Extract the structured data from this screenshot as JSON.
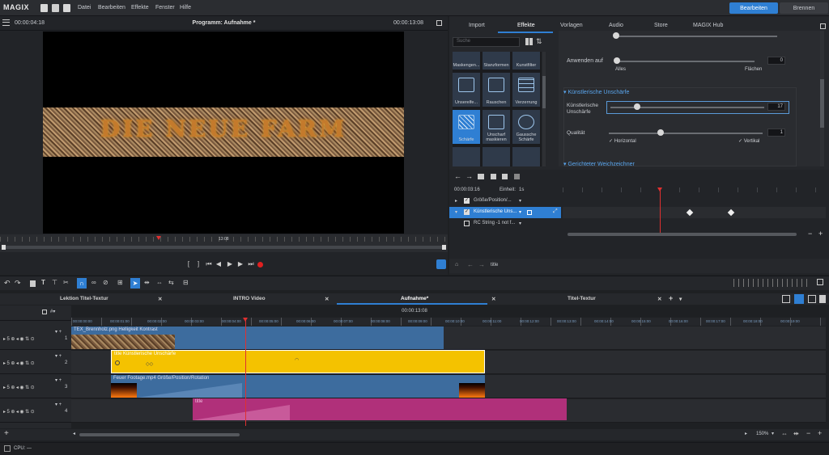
{
  "app": {
    "logo": "MAGIX",
    "menus": [
      "Datei",
      "Bearbeiten",
      "Effekte",
      "Fenster",
      "Hilfe"
    ],
    "mode_buttons": [
      "Bearbeiten",
      "Brennen"
    ]
  },
  "program": {
    "timecode_left": "00:00:04:18",
    "title": "Programm: Aufnahme *",
    "timecode_right": "00:00:13:08",
    "ruler_time": "13:08",
    "title_text": "DIE NEUE FARM"
  },
  "media_tabs": [
    "Import",
    "Effekte",
    "Vorlagen",
    "Audio",
    "Store",
    "MAGIX Hub"
  ],
  "search": {
    "placeholder": "Suche"
  },
  "effects": [
    {
      "label": "Maskengen..."
    },
    {
      "label": "Stanzformen"
    },
    {
      "label": "Kunstfilter"
    },
    {
      "label": "Unserelfe..."
    },
    {
      "label": "Rauschen"
    },
    {
      "label": "Verzerrung"
    },
    {
      "label": "Schärfe"
    },
    {
      "label": "Unscharf maskieren"
    },
    {
      "label": "Gaussche Schärfe"
    }
  ],
  "props": {
    "anwenden_label": "Anwenden auf",
    "anwenden_value": "0",
    "alles": "Alles",
    "flaechen": "Flächen",
    "section1": "Künstlerische Unschärfe",
    "ku_label": "Künstlerische Unschärfe",
    "ku_value": "17",
    "qual_label": "Qualität",
    "qual_value": "1",
    "horizontal": "Horizontal",
    "vertikal": "Vertikal",
    "section2": "Gerichteter Weichzeichner"
  },
  "keyframes": {
    "time": "00:00:03:16",
    "unit_label": "Einheit:",
    "unit": "1s",
    "rows": [
      "Größe/Position/...",
      "Künstlerische Uns...",
      "RC String -1 not f..."
    ],
    "footer": "title"
  },
  "arrangement_tabs": [
    "Lektion Titel-Textur",
    "INTRO Video",
    "Aufnahme*",
    "Titel-Textur"
  ],
  "timeline": {
    "timecode": "00:00:13:08",
    "ruler": [
      "00:00:00:00",
      "00:00:01:00",
      "00:00:02:00",
      "00:00:03:00",
      "00:00:04:00",
      "00:00:05:00",
      "00:00:06:00",
      "00:00:07:00",
      "00:00:08:00",
      "00:00:09:00",
      "00:00:10:00",
      "00:00:11:00",
      "00:00:12:00",
      "00:00:13:00",
      "00:00:14:00",
      "00:00:15:00",
      "00:00:16:00",
      "00:00:17:00",
      "00:00:18:00",
      "00:00:19:00"
    ],
    "tracks": [
      "1",
      "2",
      "3",
      "4"
    ],
    "clips": [
      {
        "label": "TEX_Brennholz.png  Helligkeit  Kontrast"
      },
      {
        "label": "title  Künstlerische Unschärfe"
      },
      {
        "label": "Feuer Footage.mp4  Größe/Position/Rotation"
      },
      {
        "label": "title"
      }
    ],
    "zoom": "150%"
  },
  "status": {
    "cpu": "CPU: —"
  },
  "colors": {
    "accent": "#2f7fd3",
    "clip_yellow": "#f4c200",
    "clip_blue": "#3d6c9e",
    "clip_pink": "#b0307a",
    "playhead": "#e03030"
  }
}
